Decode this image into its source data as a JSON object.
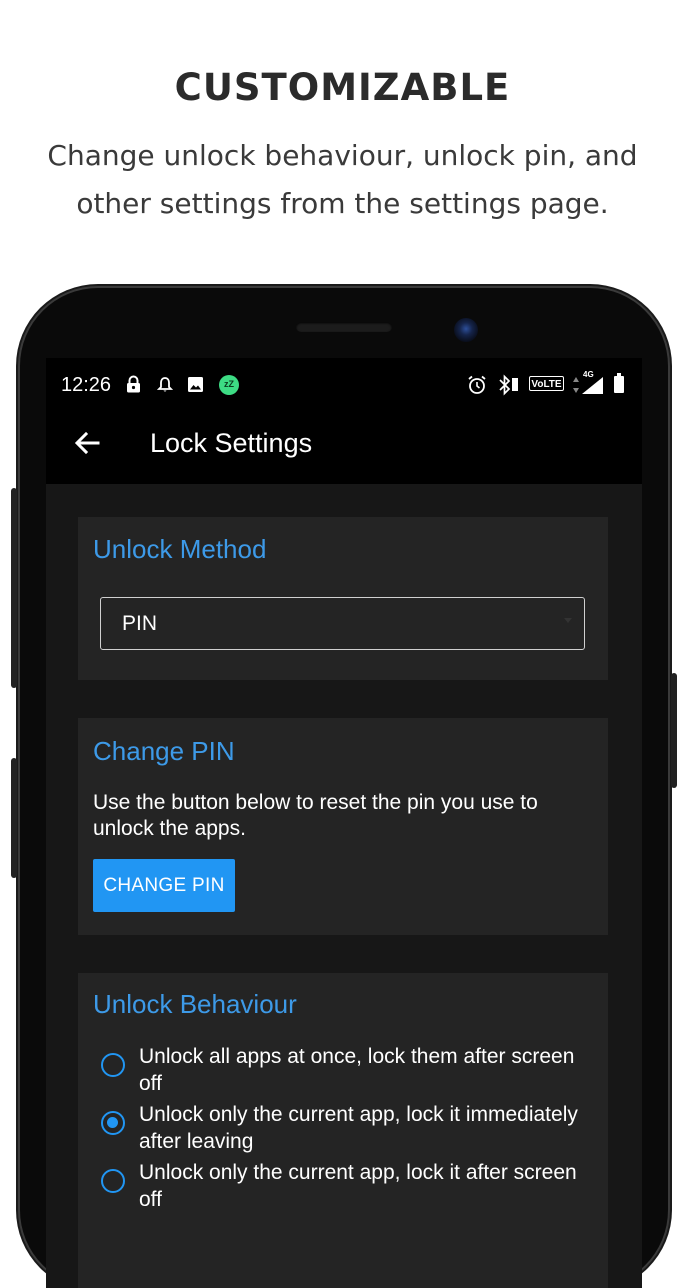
{
  "promo": {
    "title": "CUSTOMIZABLE",
    "subtitle": "Change unlock behaviour, unlock pin, and other settings from the settings page."
  },
  "status_bar": {
    "time": "12:26",
    "left_icons": [
      "lock-icon",
      "bell-icon",
      "image-icon",
      "sleep-badge-icon"
    ],
    "sleep_badge_text": "zZ",
    "right_icons": [
      "alarm-icon",
      "bluetooth-vibrate-icon",
      "volte-icon",
      "signal-4g-icon",
      "battery-icon"
    ],
    "volte_label": "VoLTE",
    "network_label": "4G"
  },
  "appbar": {
    "title": "Lock Settings",
    "back_icon": "arrow-left-icon"
  },
  "unlock_method": {
    "title": "Unlock Method",
    "selected": "PIN"
  },
  "change_pin": {
    "title": "Change PIN",
    "description": "Use the button below to reset the pin you use to unlock the apps.",
    "button_label": "CHANGE PIN"
  },
  "unlock_behaviour": {
    "title": "Unlock Behaviour",
    "options": [
      {
        "label": "Unlock all apps at once, lock them after screen off",
        "checked": false
      },
      {
        "label": "Unlock only the current app, lock it immediately after leaving",
        "checked": true
      },
      {
        "label": "Unlock only the current app, lock it after screen off",
        "checked": false
      }
    ]
  },
  "colors": {
    "accent": "#2196f3",
    "card_title": "#3d9ae8",
    "card_background": "#242424",
    "screen_background": "#171717",
    "sleep_badge": "#3ddc84"
  }
}
